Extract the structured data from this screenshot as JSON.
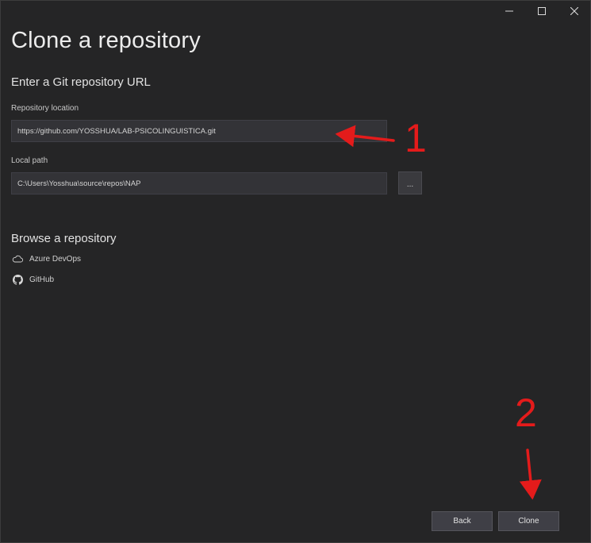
{
  "window": {
    "controls": [
      {
        "name": "minimize-button",
        "icon": "minimize-icon"
      },
      {
        "name": "maximize-button",
        "icon": "maximize-icon"
      },
      {
        "name": "close-button",
        "icon": "close-icon"
      }
    ]
  },
  "page": {
    "title": "Clone a repository"
  },
  "git_url_section": {
    "heading": "Enter a Git repository URL",
    "repository_location": {
      "label": "Repository location",
      "value": "https://github.com/YOSSHUA/LAB-PSICOLINGUISTICA.git"
    },
    "local_path": {
      "label": "Local path",
      "value": "C:\\Users\\Yosshua\\source\\repos\\NAP",
      "browse_label": "..."
    }
  },
  "browse_section": {
    "heading": "Browse a repository",
    "items": [
      {
        "label": "Azure DevOps",
        "icon": "cloud-icon"
      },
      {
        "label": "GitHub",
        "icon": "github-icon"
      }
    ]
  },
  "footer": {
    "back_label": "Back",
    "clone_label": "Clone"
  },
  "annotations": {
    "step1": "1",
    "step2": "2",
    "color": "#e41b1b"
  },
  "colors": {
    "background": "#252526",
    "field_background": "#333337",
    "button_background": "#3f3f46",
    "text": "#e2e2e2"
  }
}
